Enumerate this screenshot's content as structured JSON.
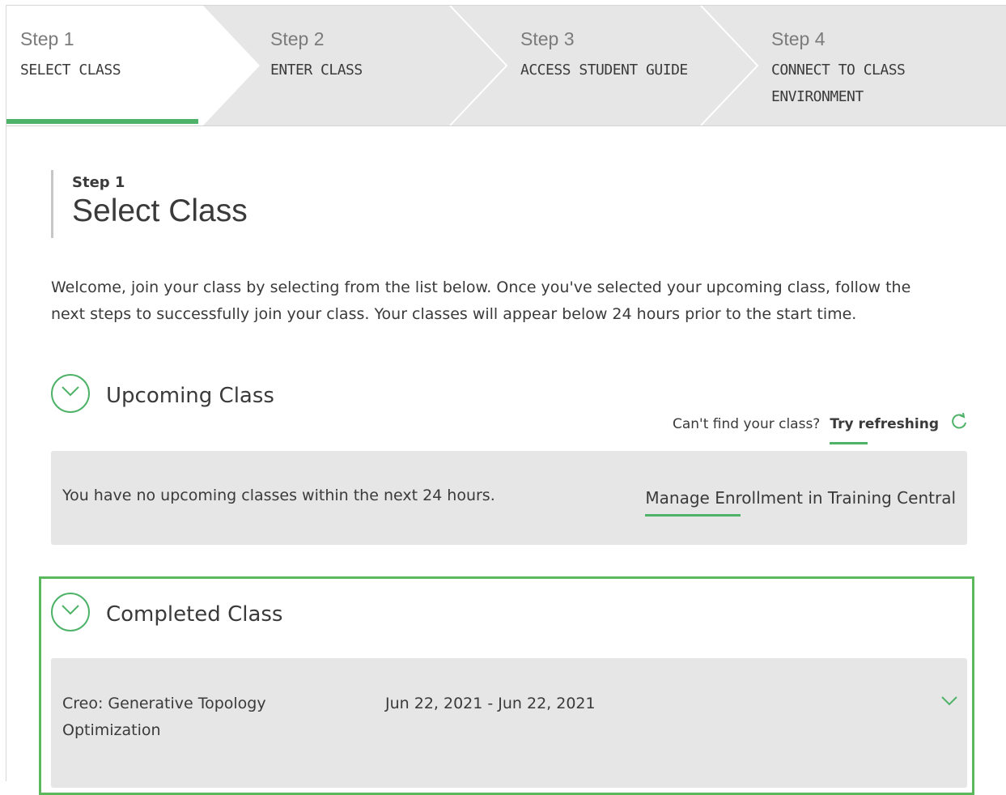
{
  "stepper": {
    "steps": [
      {
        "num": "Step 1",
        "label": "SELECT CLASS",
        "active": true
      },
      {
        "num": "Step 2",
        "label": "ENTER CLASS",
        "active": false
      },
      {
        "num": "Step 3",
        "label": "ACCESS STUDENT GUIDE",
        "active": false
      },
      {
        "num": "Step 4",
        "label": "CONNECT TO CLASS ENVIRONMENT",
        "active": false
      }
    ]
  },
  "heading": {
    "small": "Step 1",
    "title": "Select Class"
  },
  "intro": "Welcome, join your class by selecting from the list below. Once you've selected your upcoming class, follow the next steps to successfully join your class. Your classes will appear below 24 hours prior to the start time.",
  "upcoming": {
    "title": "Upcoming Class",
    "cant_find": "Can't find your class?",
    "try_refresh": "Try refreshing",
    "empty_msg": "You have no upcoming classes within the next 24 hours.",
    "manage_link": "Manage Enrollment in Training Central"
  },
  "completed": {
    "title": "Completed Class",
    "classes": [
      {
        "name": "Creo: Generative Topology Optimization",
        "dates": "Jun 22, 2021 - Jun 22, 2021"
      }
    ]
  },
  "colors": {
    "accent": "#4fb269",
    "highlight_border": "#5cb85c",
    "panel": "#e6e6e6"
  },
  "icons": [
    "chevron-down-circle-icon",
    "refresh-icon",
    "chevron-down-icon"
  ]
}
